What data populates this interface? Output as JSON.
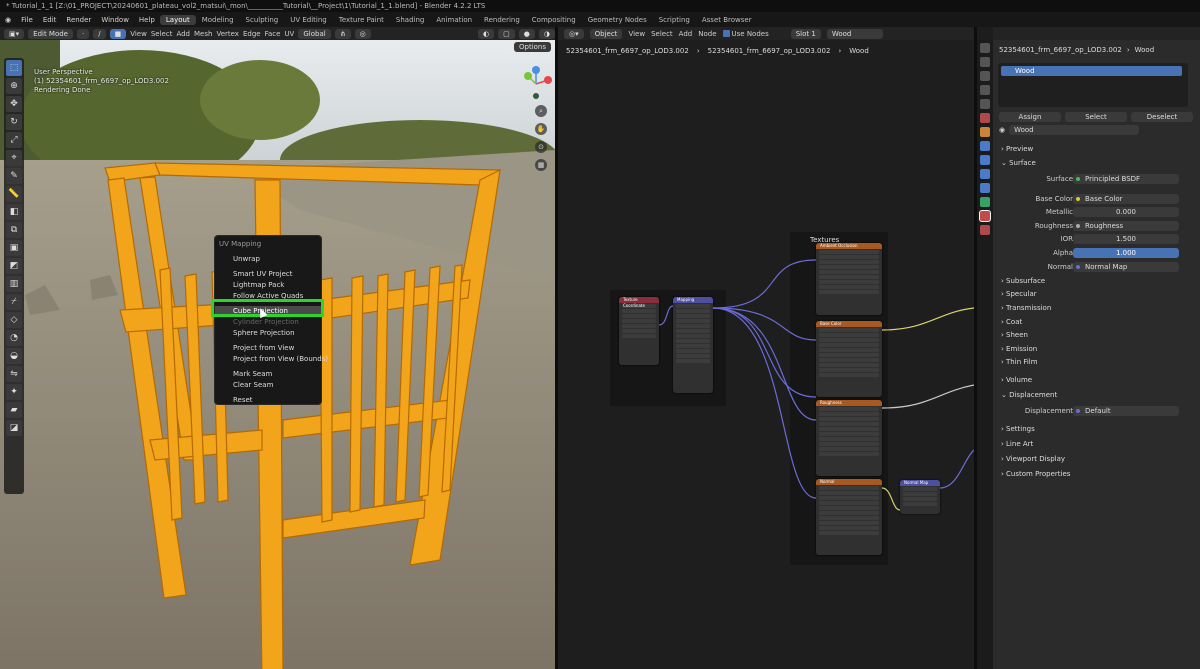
{
  "window": {
    "title": "* Tutorial_1_1 [Z:\\01_PROJECT\\20240601_plateau_vol2_matsui\\_mon\\__________Tutorial\\__Project\\1\\Tutorial_1_1.blend] - Blender 4.2.2 LTS"
  },
  "menu": {
    "items": [
      "File",
      "Edit",
      "Render",
      "Window",
      "Help"
    ]
  },
  "workspaces": {
    "tabs": [
      "Layout",
      "Modeling",
      "Sculpting",
      "UV Editing",
      "Texture Paint",
      "Shading",
      "Animation",
      "Rendering",
      "Compositing",
      "Geometry Nodes",
      "Scripting",
      "Asset Browser"
    ],
    "active": "Layout"
  },
  "viewport": {
    "mode": "Edit Mode",
    "header_menus": [
      "View",
      "Select",
      "Add",
      "Mesh",
      "Vertex",
      "Edge",
      "Face",
      "UV"
    ],
    "orientation": "Global",
    "options_label": "Options",
    "info_lines": [
      "User Perspective",
      "(1) 52354601_frm_6697_op_LOD3.002",
      "Rendering Done"
    ]
  },
  "uv_menu": {
    "title": "UV Mapping",
    "items": [
      "Unwrap",
      "Smart UV Project",
      "Lightmap Pack",
      "Follow Active Quads",
      "Cube Projection",
      "Cylinder Projection",
      "Sphere Projection",
      "Project from View",
      "Project from View (Bounds)",
      "Mark Seam",
      "Clear Seam",
      "Reset"
    ],
    "highlighted": "Cube Projection"
  },
  "node_editor": {
    "header": {
      "type": "Object",
      "menus": [
        "View",
        "Select",
        "Add",
        "Node"
      ],
      "use_nodes_label": "Use Nodes",
      "slot": "Slot 1",
      "material": "Wood"
    },
    "breadcrumb": [
      "52354601_frm_6697_op_LOD3.002",
      "52354601_frm_6697_op_LOD3.002",
      "Wood"
    ],
    "frame_label": "Textures",
    "nodes": {
      "texcoord": "Texture Coordinate",
      "mapping": "Mapping",
      "ambient": "Ambient Occlusion",
      "basecolor": "Base Color",
      "roughness": "Roughness",
      "normal": "Normal",
      "normalmap": "Normal Map"
    }
  },
  "properties": {
    "breadcrumb": [
      "52354601_frm_6697_op_LOD3.002",
      "Wood"
    ],
    "slot_name": "Wood",
    "buttons": [
      "Assign",
      "Select",
      "Deselect"
    ],
    "material_name": "Wood",
    "sections": {
      "preview": "Preview",
      "surface": "Surface"
    },
    "surface_label": "Surface",
    "surface_value": "Principled BSDF",
    "base_color_label": "Base Color",
    "base_color_value": "Base Color",
    "metallic_label": "Metallic",
    "metallic_value": "0.000",
    "roughness_label": "Roughness",
    "roughness_value": "Roughness",
    "ior_label": "IOR",
    "ior_value": "1.500",
    "alpha_label": "Alpha",
    "alpha_value": "1.000",
    "normal_label": "Normal",
    "normal_value": "Normal Map",
    "sub_sections": [
      "Subsurface",
      "Specular",
      "Transmission",
      "Coat",
      "Sheen",
      "Emission",
      "Thin Film"
    ],
    "volume": "Volume",
    "displacement": "Displacement",
    "displacement_label": "Displacement",
    "displacement_value": "Default",
    "tail_sections": [
      "Settings",
      "Line Art",
      "Viewport Display",
      "Custom Properties"
    ]
  }
}
